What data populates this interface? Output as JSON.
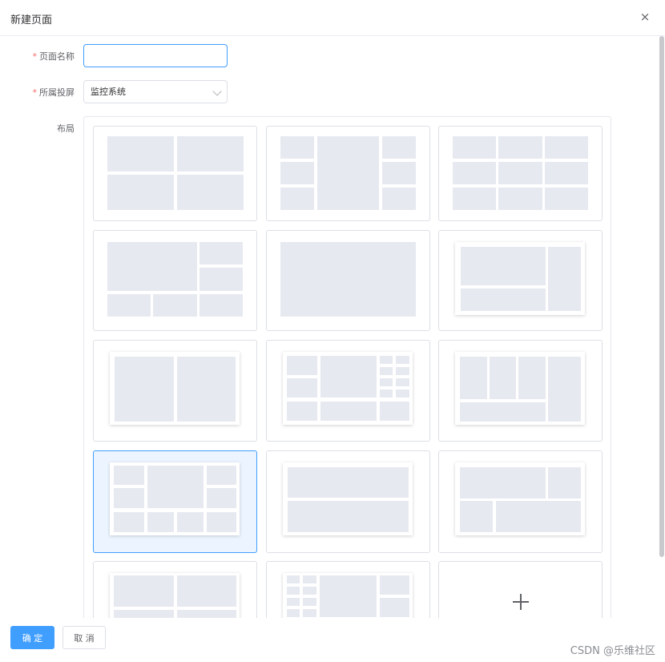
{
  "dialog": {
    "title": "新建页面",
    "close_label": "×"
  },
  "form": {
    "page_name_label": "页面名称",
    "page_name_value": "",
    "screen_label": "所属投屏",
    "screen_value": "监控系统",
    "layout_label": "布局",
    "required_mark": "*"
  },
  "layouts": {
    "count": 15,
    "selected_index": 9,
    "add_card_icon": "plus-icon"
  },
  "footer": {
    "confirm_label": "确 定",
    "cancel_label": "取 消",
    "watermark": "CSDN @乐维社区"
  },
  "colors": {
    "primary": "#409eff",
    "selected_bg": "#ecf5ff",
    "block": "#e7e9f0",
    "required": "#f56c6c"
  }
}
